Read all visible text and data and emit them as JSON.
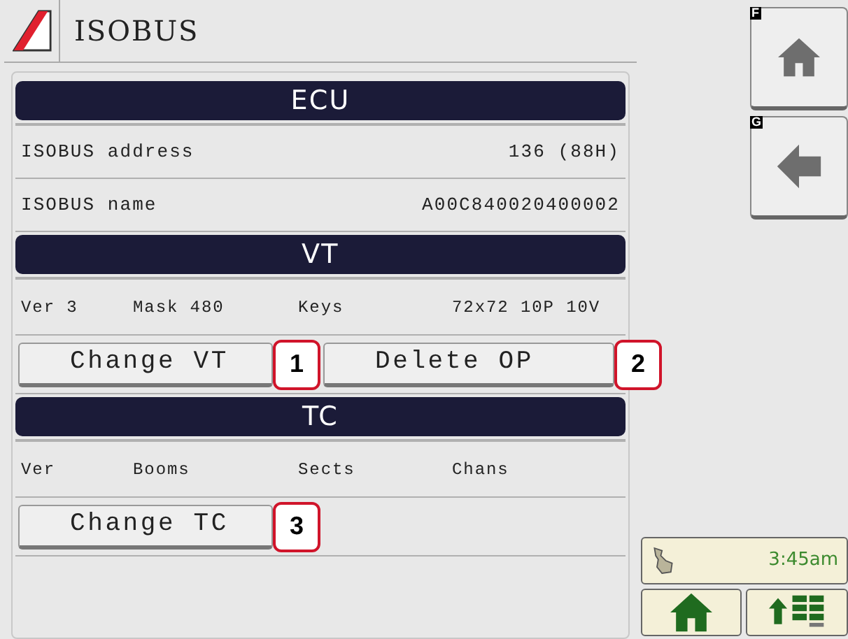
{
  "title": "ISOBUS",
  "sections": [
    {
      "heading": "ECU",
      "rows": [
        {
          "kind": "pair",
          "label": "ISOBUS address",
          "value": "136 (88H)"
        },
        {
          "kind": "pair",
          "label": "ISOBUS name",
          "value": "A00C840020400002"
        }
      ]
    },
    {
      "heading": "VT",
      "rows": [
        {
          "kind": "cells",
          "cells": [
            "Ver 3",
            "Mask 480",
            "Keys",
            "72x72 10P 10V"
          ]
        },
        {
          "kind": "buttons",
          "buttons": [
            {
              "label": "Change VT",
              "callout": "1"
            },
            {
              "label": "Delete OP",
              "callout": "2"
            }
          ]
        }
      ]
    },
    {
      "heading": "TC",
      "rows": [
        {
          "kind": "cells",
          "cells": [
            "Ver",
            "Booms",
            "Sects",
            "Chans"
          ]
        },
        {
          "kind": "buttons",
          "buttons": [
            {
              "label": "Change TC",
              "callout": "3"
            }
          ]
        }
      ]
    }
  ],
  "softkeys": [
    {
      "key": "F",
      "kind": "home"
    },
    {
      "key": "G",
      "kind": "back"
    }
  ],
  "status": {
    "time": "3:45am"
  },
  "bottom_buttons": [
    {
      "kind": "home"
    },
    {
      "kind": "up-grid"
    }
  ]
}
